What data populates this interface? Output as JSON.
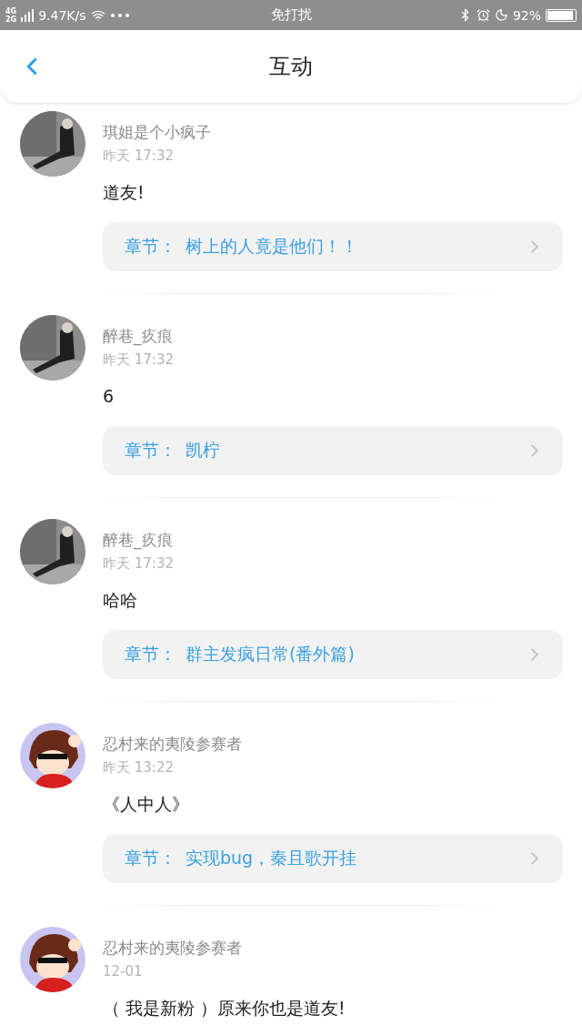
{
  "status_bar": {
    "network_labels": [
      "4G",
      "2G"
    ],
    "speed": "9.47K/s",
    "mode": "免打扰",
    "battery": "92%"
  },
  "header": {
    "title": "互动"
  },
  "comments": [
    {
      "name": "琪姐是个小疯子",
      "time": "昨天 17:32",
      "text": "道友!",
      "chapter_label": "章节：",
      "chapter": "树上的人竟是他们！！"
    },
    {
      "name": "醉巷_疚痕",
      "time": "昨天 17:32",
      "text": "6",
      "chapter_label": "章节：",
      "chapter": "凯柠"
    },
    {
      "name": "醉巷_疚痕",
      "time": "昨天 17:32",
      "text": "哈哈",
      "chapter_label": "章节：",
      "chapter": "群主发疯日常(番外篇)"
    },
    {
      "name": "忍村来的夷陵参赛者",
      "time": "昨天 13:22",
      "text": "《人中人》",
      "chapter_label": "章节：",
      "chapter": "实现bug，秦且歌开挂"
    },
    {
      "name": "忍村来的夷陵参赛者",
      "time": "12-01",
      "text": "（ 我是新粉 ）原来你也是道友!"
    }
  ]
}
